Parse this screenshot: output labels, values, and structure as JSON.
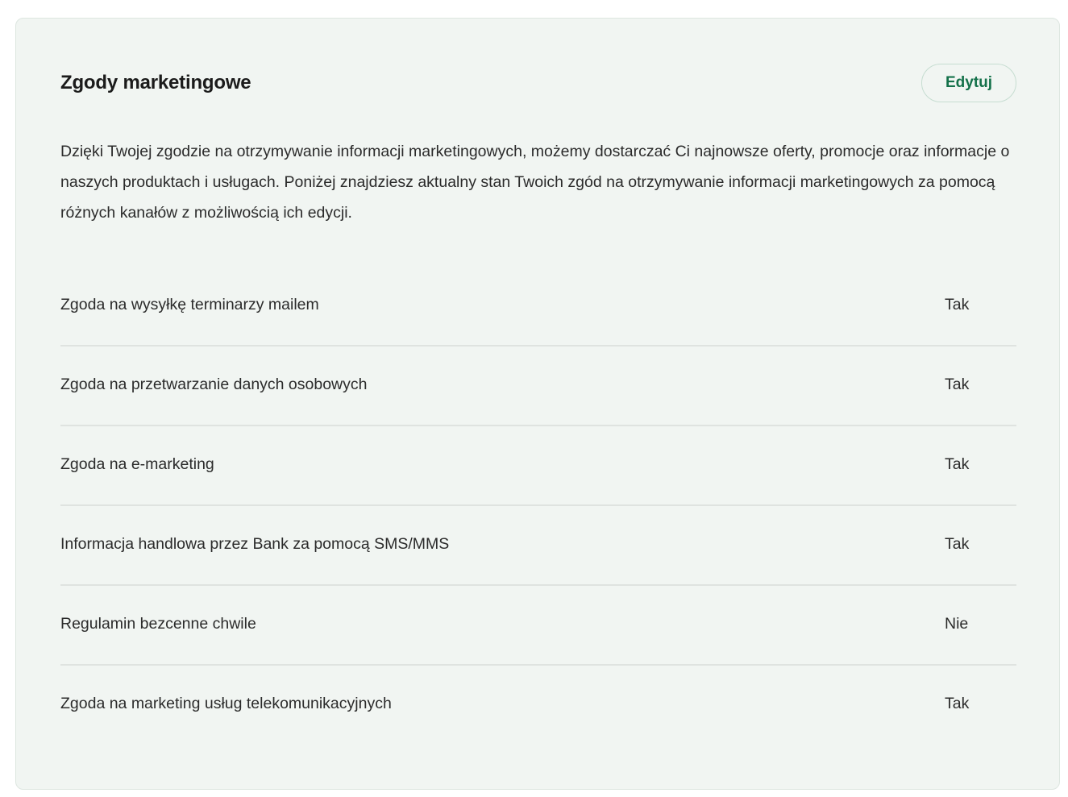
{
  "card": {
    "title": "Zgody marketingowe",
    "edit_label": "Edytuj",
    "description": "Dzięki Twojej zgodzie na otrzymywanie informacji marketingowych, możemy dostarczać Ci najnowsze oferty, promocje oraz informacje o naszych produktach i usługach. Poniżej znajdziesz aktualny stan Twoich zgód na otrzymywanie informacji marketingowych za pomocą różnych kanałów z możliwością ich edycji."
  },
  "consents": [
    {
      "label": "Zgoda na wysyłkę terminarzy mailem",
      "value": "Tak"
    },
    {
      "label": "Zgoda na przetwarzanie danych osobowych",
      "value": "Tak"
    },
    {
      "label": "Zgoda na e-marketing",
      "value": "Tak"
    },
    {
      "label": "Informacja handlowa przez Bank za pomocą SMS/MMS",
      "value": "Tak"
    },
    {
      "label": "Regulamin bezcenne chwile",
      "value": "Nie"
    },
    {
      "label": "Zgoda na marketing usług telekomunikacyjnych",
      "value": "Tak"
    }
  ],
  "colors": {
    "card_background": "#f1f5f2",
    "accent": "#14714a",
    "divider": "#dfe3e0"
  }
}
